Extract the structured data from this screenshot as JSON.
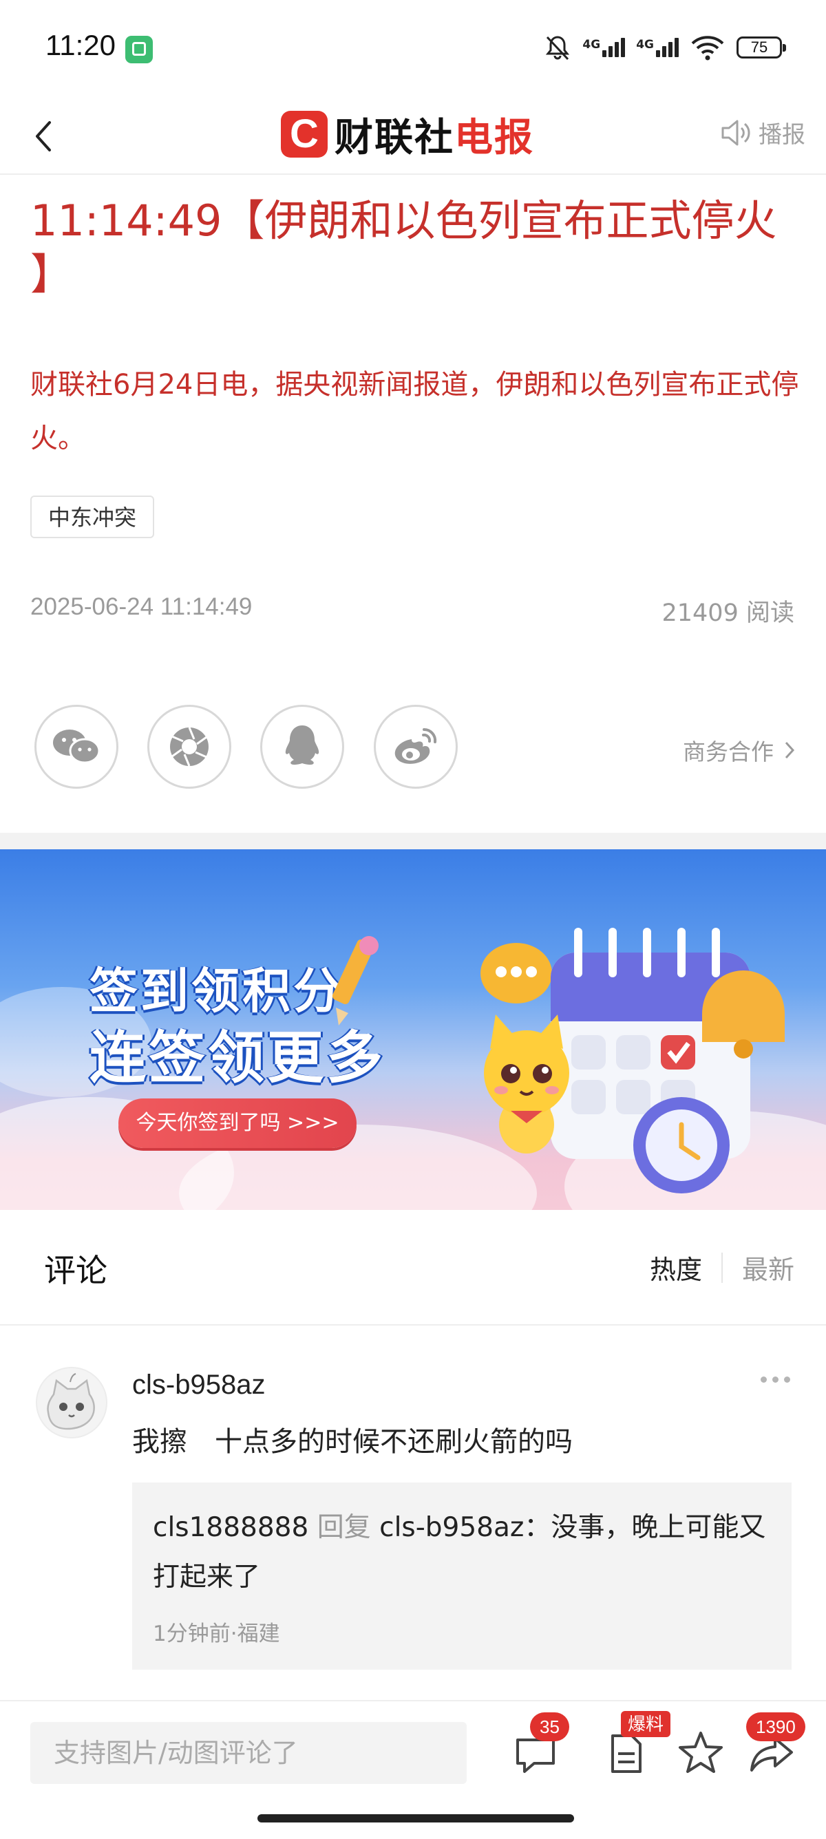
{
  "status_bar": {
    "time": "11:20",
    "battery": "75",
    "network_1": "4G",
    "network_2": "4G"
  },
  "nav": {
    "logo_letter": "C",
    "logo_text_black": "财联社",
    "logo_text_red": "电报",
    "broadcast_label": "播报"
  },
  "article": {
    "title_line1": "11:14:49【伊朗和以色列宣布正式停火",
    "title_line2": "】",
    "lead": "财联社6月24日电，据央视新闻报道，伊朗和以色列宣布正式停火。",
    "tag": "中东冲突",
    "datetime": "2025-06-24 11:14:49",
    "read_count": "21409",
    "read_label": "阅读"
  },
  "share": {
    "icons": [
      "wechat-icon",
      "moments-icon",
      "qq-icon",
      "weibo-icon"
    ],
    "business_label": "商务合作"
  },
  "banner": {
    "line1": "签到领积分",
    "line2": "连签领更多",
    "button": "今天你签到了吗 >>>"
  },
  "comments": {
    "title": "评论",
    "sort_hot": "热度",
    "sort_new": "最新",
    "items": [
      {
        "user": "cls-b958az",
        "text": "我擦　十点多的时候不还刷火箭的吗",
        "reply": {
          "user": "cls1888888",
          "verb": "回复",
          "to": "cls-b958az",
          "text": "：没事，晚上可能又打起来了",
          "meta": "1分钟前·福建"
        }
      }
    ]
  },
  "bottom_bar": {
    "input_placeholder": "支持图片/动图评论了",
    "comment_count": "35",
    "report_badge": "爆料",
    "share_count": "1390"
  },
  "colors": {
    "accent_red": "#c6302b",
    "brand_red": "#e3322b",
    "muted_gray": "#9a9a9a"
  }
}
